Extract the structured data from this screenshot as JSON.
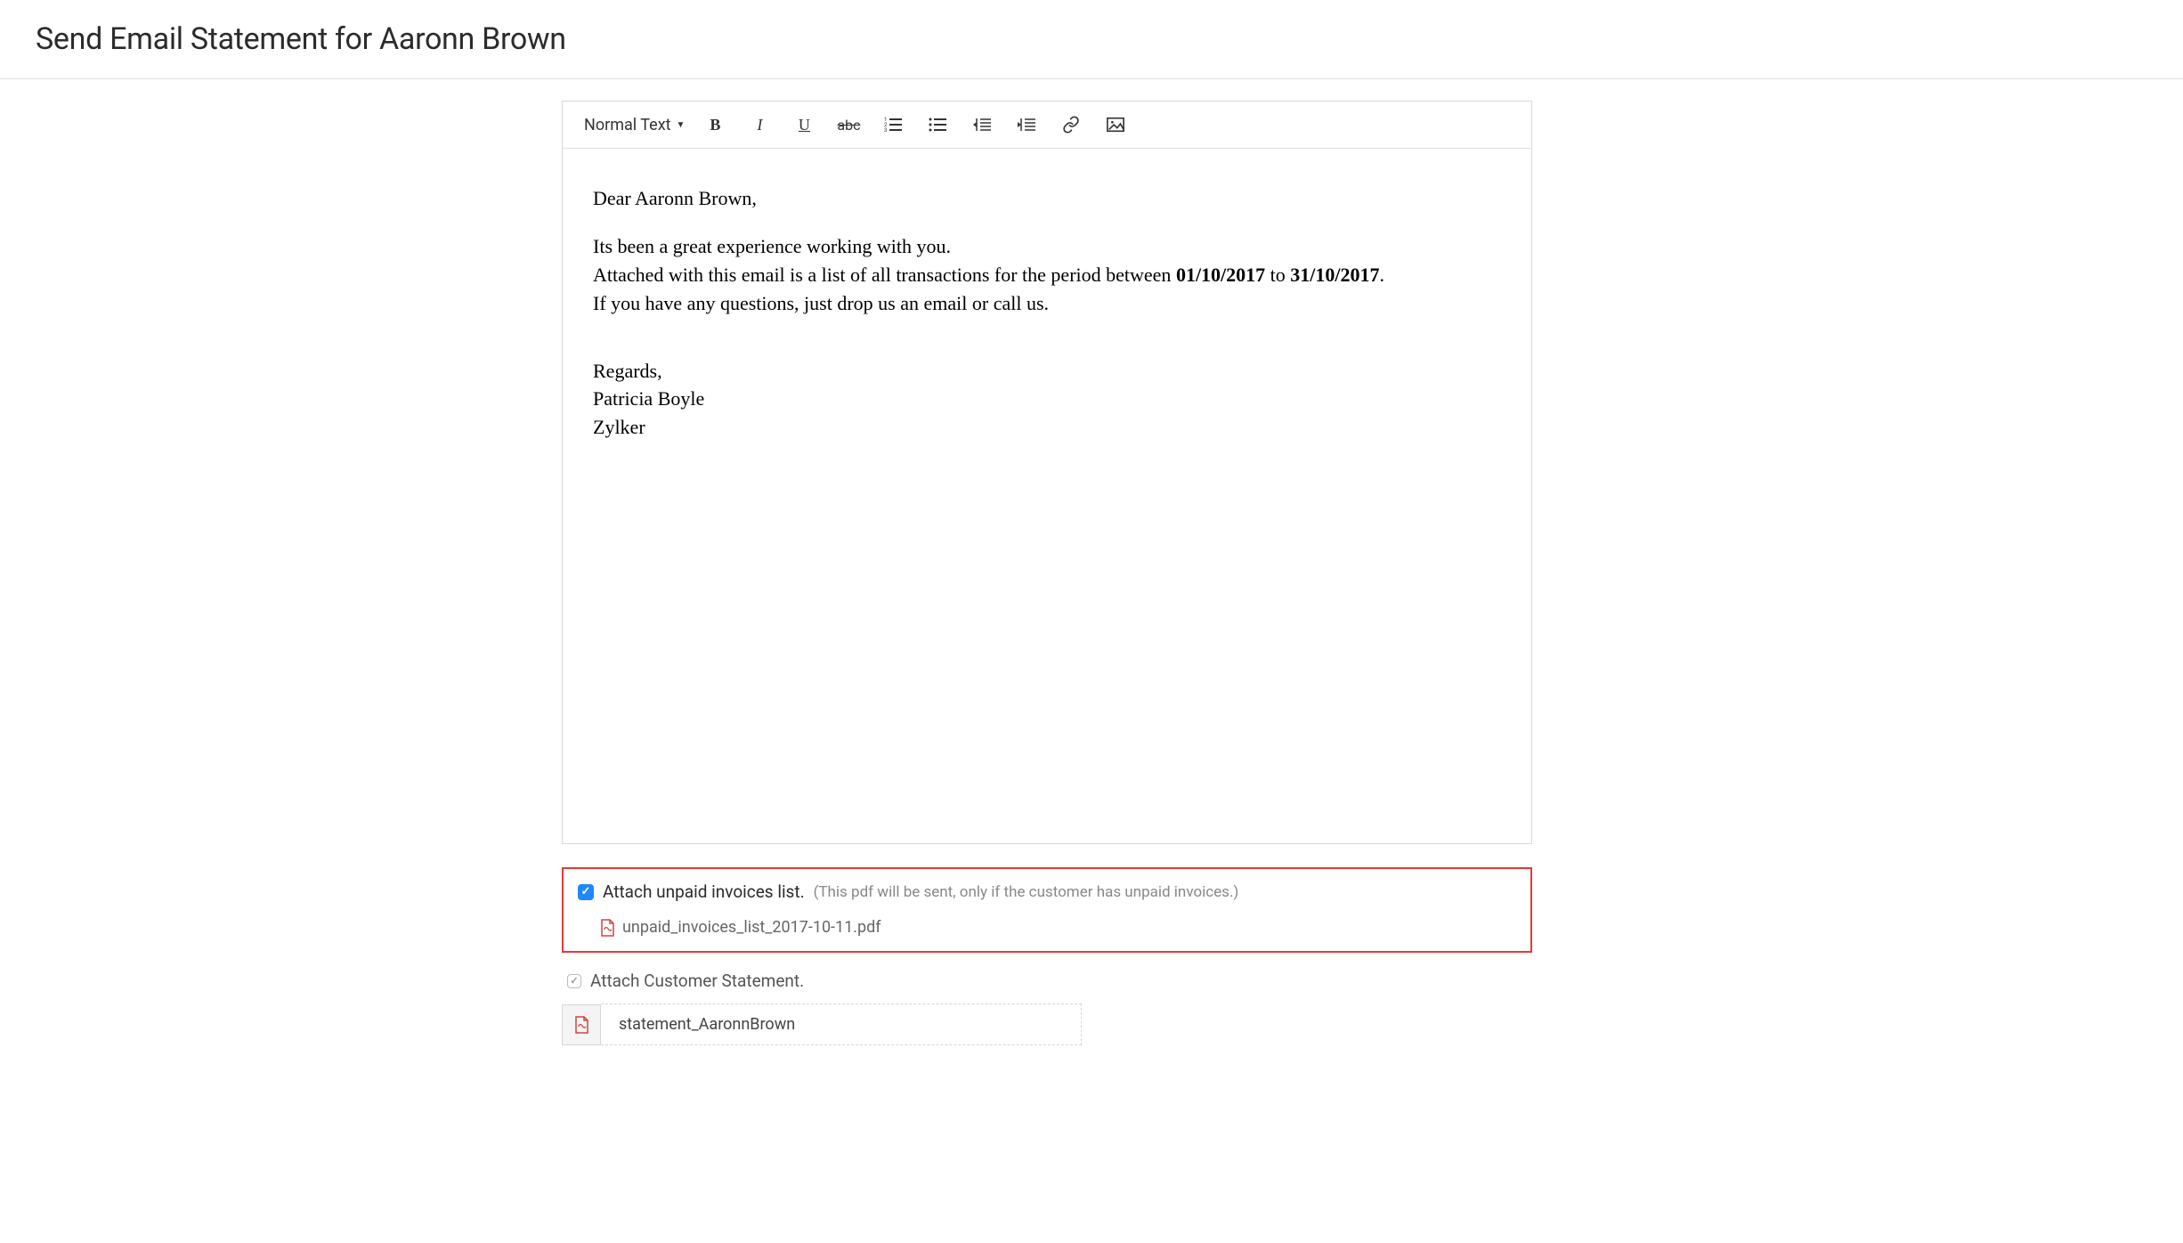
{
  "header": {
    "title": "Send Email Statement for Aaronn Brown"
  },
  "toolbar": {
    "text_style_label": "Normal Text",
    "bold": "B",
    "italic": "I",
    "underline": "U",
    "strike": "abc"
  },
  "email_body": {
    "greeting": "Dear Aaronn Brown,",
    "line1": "Its been a great experience working with you.",
    "line2_prefix": "Attached with this email is a list of all transactions for the period between ",
    "date_from": "01/10/2017",
    "line2_mid": " to ",
    "date_to": "31/10/2017",
    "line2_suffix": ".",
    "line3": "If you have any questions, just drop us an email or call us.",
    "regards": "Regards,",
    "sender_name": "Patricia Boyle",
    "sender_company": "Zylker"
  },
  "attachments": {
    "unpaid_label": "Attach unpaid invoices list.",
    "unpaid_hint": "(This pdf will be sent, only if the customer has unpaid invoices.)",
    "unpaid_file": "unpaid_invoices_list_2017-10-11.pdf",
    "statement_label": "Attach Customer Statement.",
    "statement_file": "statement_AaronnBrown"
  }
}
